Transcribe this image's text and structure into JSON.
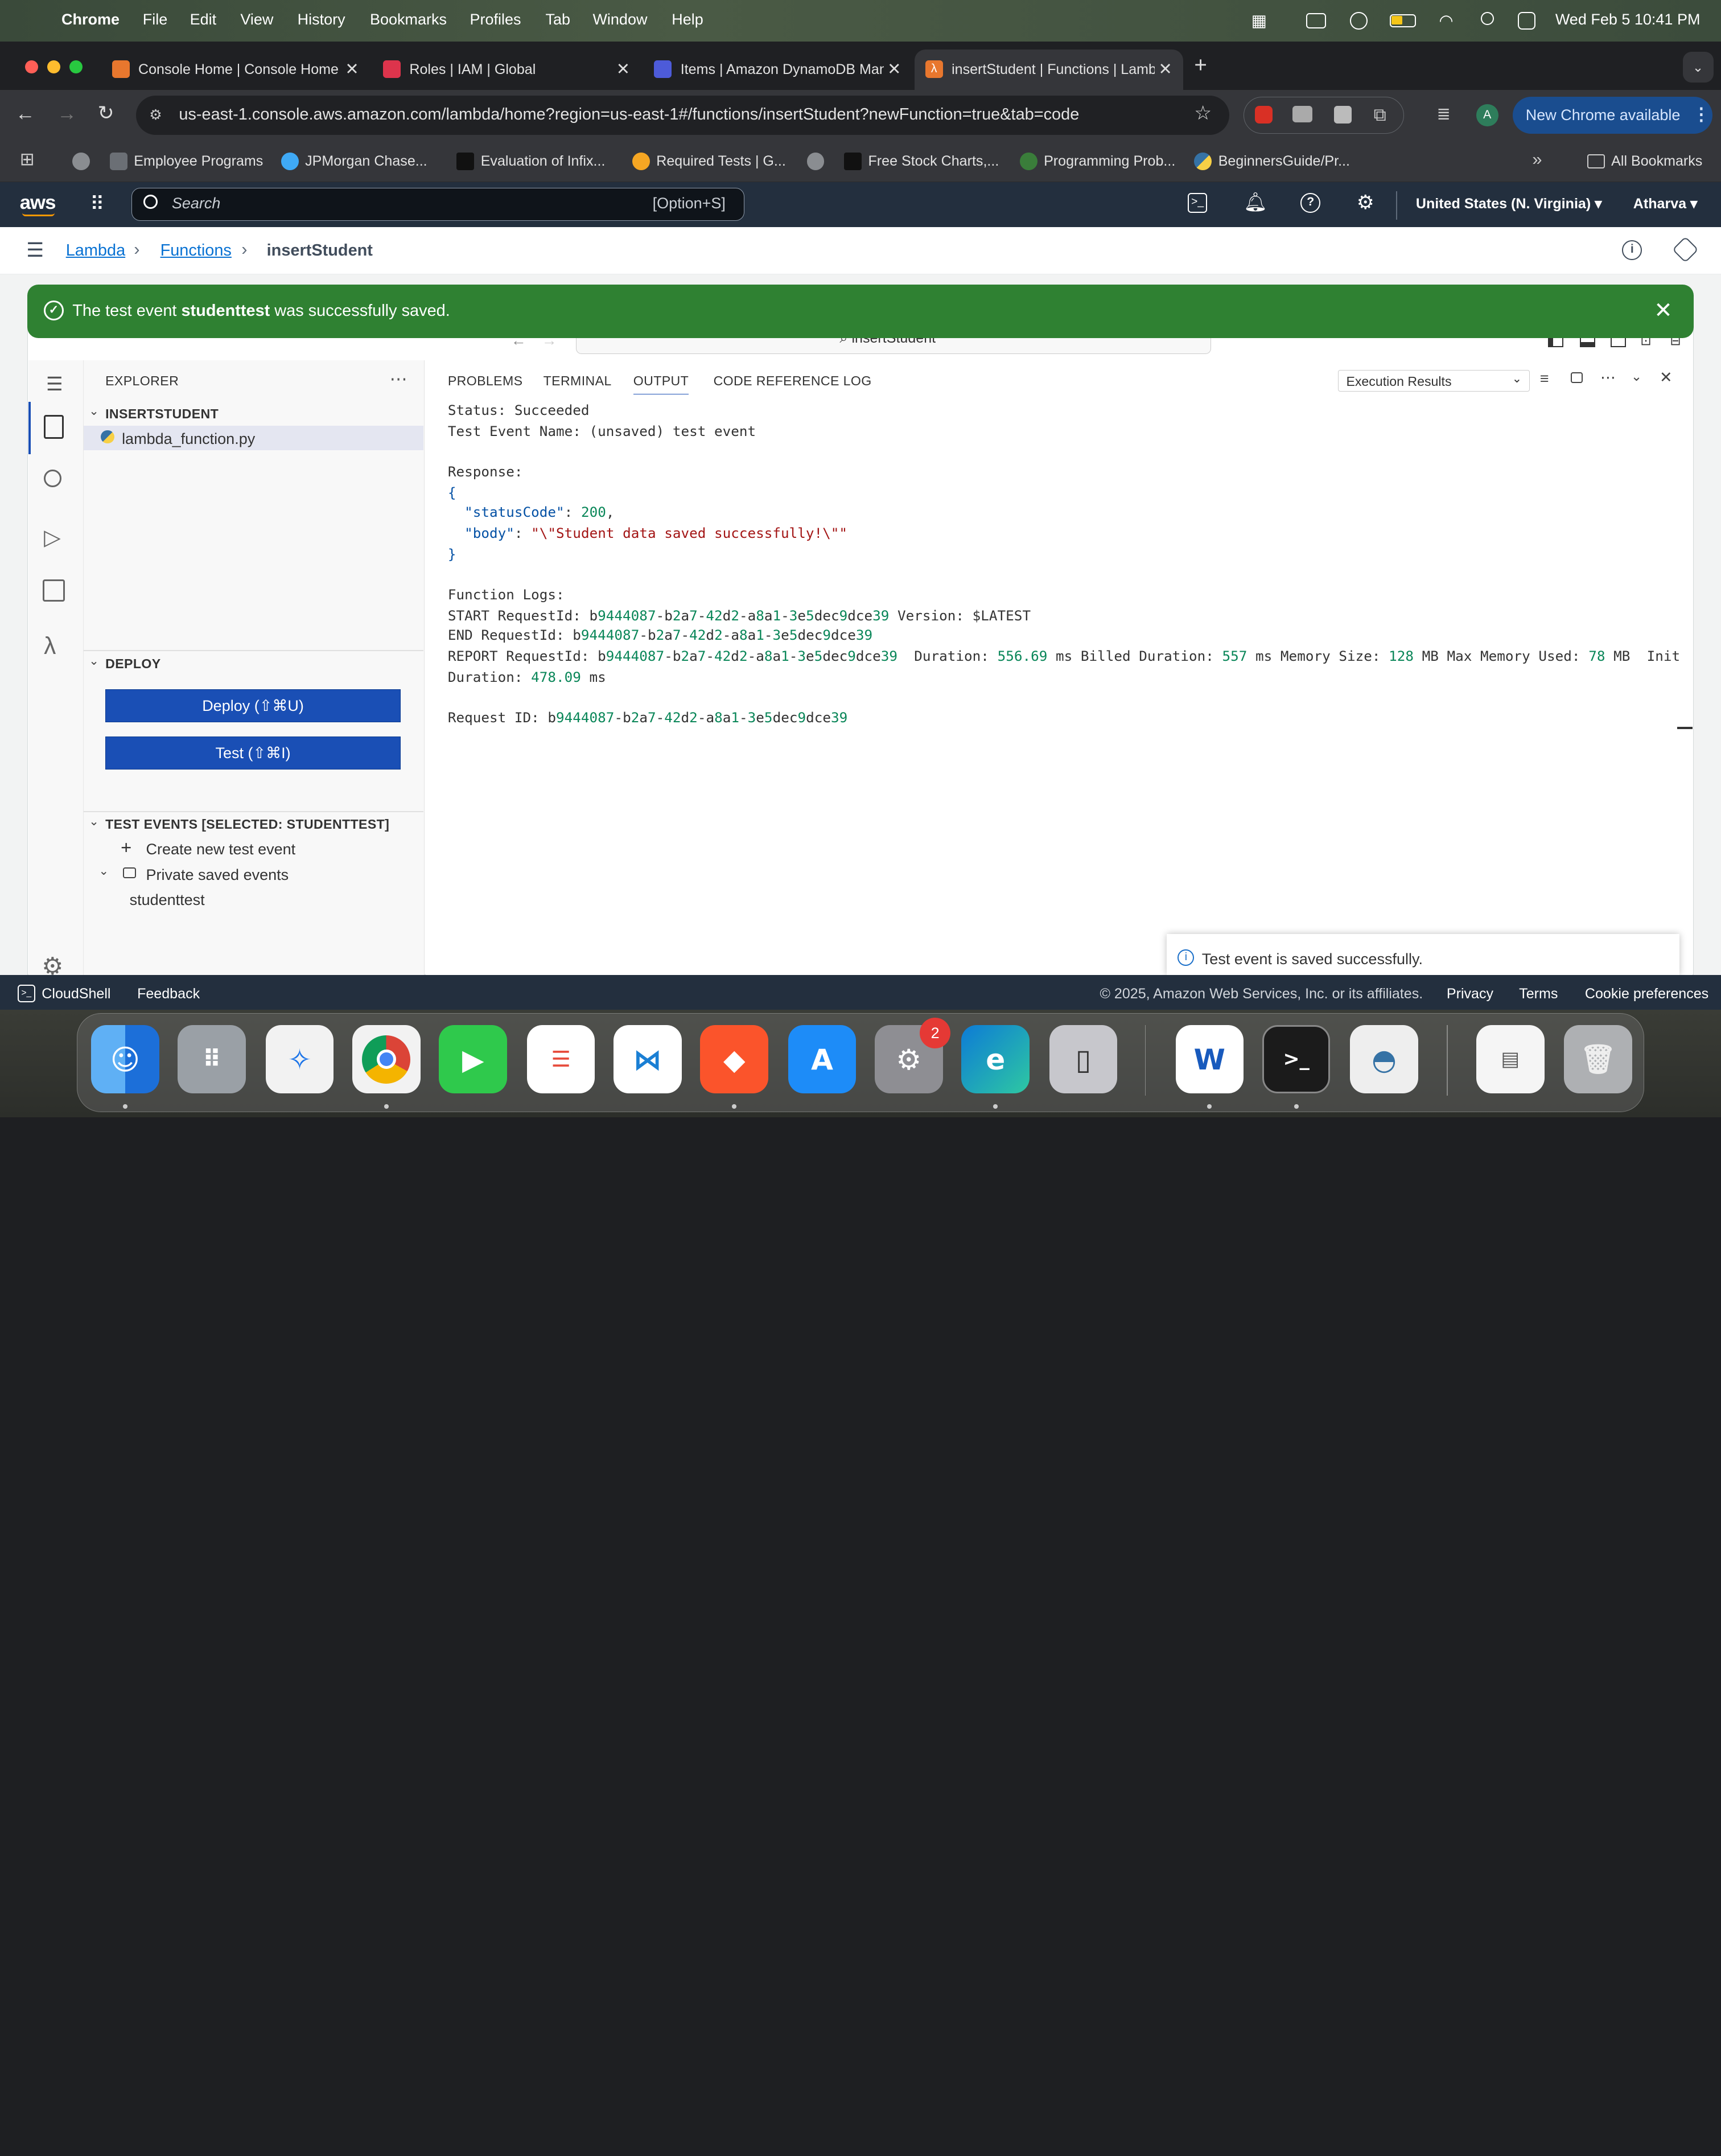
{
  "menubar": {
    "app": "Chrome",
    "items": [
      "File",
      "Edit",
      "View",
      "History",
      "Bookmarks",
      "Profiles",
      "Tab",
      "Window",
      "Help"
    ],
    "datetime": "Wed Feb 5  10:41 PM"
  },
  "tabs": [
    {
      "title": "Console Home | Console Home",
      "color": "#e8772e"
    },
    {
      "title": "Roles | IAM | Global",
      "color": "#dd344c"
    },
    {
      "title": "Items | Amazon DynamoDB Management Console",
      "color": "#4d5bd9"
    },
    {
      "title": "insertStudent | Functions | Lambda",
      "color": "#e8772e"
    }
  ],
  "toolbar": {
    "url": "us-east-1.console.aws.amazon.com/lambda/home?region=us-east-1#/functions/insertStudent?newFunction=true&tab=code",
    "profile_initial": "A",
    "update_label": "New Chrome available"
  },
  "bookmarks": {
    "items": [
      {
        "label": "Employee Programs"
      },
      {
        "label": "JPMorgan Chase..."
      },
      {
        "label": "Evaluation of Infix..."
      },
      {
        "label": "Required Tests | G..."
      },
      {
        "label": "Free Stock Charts,..."
      },
      {
        "label": "Programming Prob..."
      },
      {
        "label": "BeginnersGuide/Pr..."
      }
    ],
    "more": "»",
    "all": "All Bookmarks"
  },
  "aws": {
    "logo": "aws",
    "search_placeholder": "Search",
    "search_shortcut": "[Option+S]",
    "region": "United States (N. Virginia)",
    "user": "Atharva"
  },
  "breadcrumb": {
    "lambda": "Lambda",
    "functions": "Functions",
    "current": "insertStudent"
  },
  "flash": {
    "prefix": "The test event ",
    "event": "studenttest",
    "suffix": " was successfully saved."
  },
  "ide": {
    "search_label": "insertStudent",
    "explorer_title": "EXPLORER",
    "project": "INSERTSTUDENT",
    "file": "lambda_function.py",
    "deploy_section": "DEPLOY",
    "deploy_button": "Deploy (⇧⌘U)",
    "test_button": "Test (⇧⌘I)",
    "test_events_section": "TEST EVENTS [SELECTED: STUDENTTEST]",
    "create_event": "Create new test event",
    "private_events": "Private saved events",
    "saved_event": "studenttest",
    "panel_tabs": [
      "PROBLEMS",
      "TERMINAL",
      "OUTPUT",
      "CODE REFERENCE LOG"
    ],
    "active_panel": "OUTPUT",
    "output_select": "Execution Results",
    "toast": "Test event is saved successfully."
  },
  "output": {
    "status": "Status: Succeeded",
    "test_event_name": "Test Event Name: (unsaved) test event",
    "response_label": "Response:",
    "open_brace": "{",
    "status_code_key": "\"statusCode\"",
    "status_code_val": "200",
    "body_key": "\"body\"",
    "body_val": "\"\\\"Student data saved successfully!\\\"\"",
    "close_brace": "}",
    "logs_label": "Function Logs:",
    "start_line": "START RequestId: b9444087-b2a7-42d2-a8a1-3e5dec9dce39 Version: $LATEST",
    "end_line": "END RequestId: b9444087-b2a7-42d2-a8a1-3e5dec9dce39",
    "report_line": "REPORT RequestId: b9444087-b2a7-42d2-a8a1-3e5dec9dce39  Duration: 556.69 ms Billed Duration: 557 ms Memory Size: 128 MB Max Memory Used: 78 MB  Init",
    "report_line2": "Duration: 478.09 ms",
    "request_id": "Request ID: b9444087-b2a7-42d2-a8a1-3e5dec9dce39"
  },
  "footer": {
    "cloudshell": "CloudShell",
    "feedback": "Feedback",
    "copyright": "© 2025, Amazon Web Services, Inc. or its affiliates.",
    "privacy": "Privacy",
    "terms": "Terms",
    "cookies": "Cookie preferences"
  },
  "dock": {
    "apps": [
      "Finder",
      "Launchpad",
      "Safari",
      "Chrome",
      "FaceTime",
      "Reminders",
      "VS Code",
      "Brave",
      "App Store",
      "System Settings",
      "Edge",
      "iPhone Mirroring",
      "Word",
      "Terminal",
      "Python Launcher",
      "Preview",
      "Trash"
    ],
    "settings_badge": "2"
  }
}
